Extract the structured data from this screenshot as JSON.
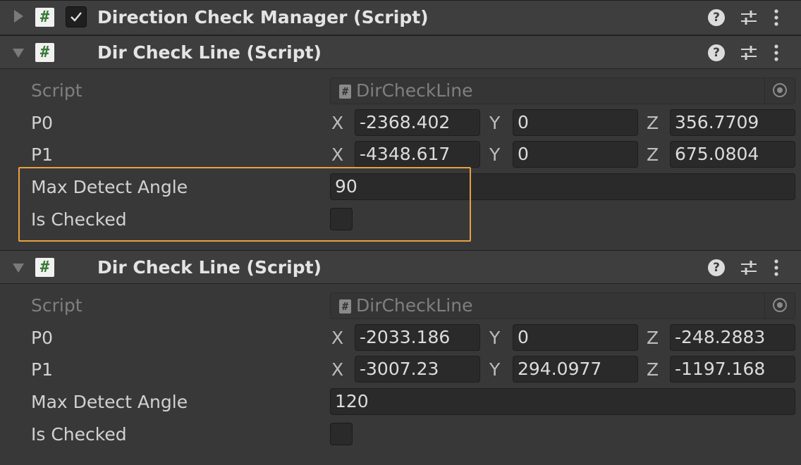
{
  "components": [
    {
      "title": "Direction Check Manager (Script)",
      "collapsed": true,
      "enabled": true
    },
    {
      "title": "Dir Check Line (Script)",
      "script_label": "Script",
      "script_value": "DirCheckLine",
      "p0_label": "P0",
      "p0": {
        "x": "-2368.402",
        "y": "0",
        "z": "356.7709"
      },
      "p1_label": "P1",
      "p1": {
        "x": "-4348.617",
        "y": "0",
        "z": "675.0804"
      },
      "max_angle_label": "Max Detect Angle",
      "max_angle": "90",
      "is_checked_label": "Is Checked",
      "is_checked": false
    },
    {
      "title": "Dir Check Line (Script)",
      "script_label": "Script",
      "script_value": "DirCheckLine",
      "p0_label": "P0",
      "p0": {
        "x": "-2033.186",
        "y": "0",
        "z": "-248.2883"
      },
      "p1_label": "P1",
      "p1": {
        "x": "-3007.23",
        "y": "294.0977",
        "z": "-1197.168"
      },
      "max_angle_label": "Max Detect Angle",
      "max_angle": "120",
      "is_checked_label": "Is Checked",
      "is_checked": false
    }
  ],
  "axes": {
    "x": "X",
    "y": "Y",
    "z": "Z"
  },
  "icons": {
    "script": "script-file-icon",
    "help": "help-icon",
    "presets": "presets-icon",
    "menu": "kebab-menu-icon",
    "picker": "object-picker-icon"
  },
  "glyphs": {
    "script": "#",
    "help": "?"
  },
  "colors": {
    "highlight": "#e8a140",
    "background": "#383838"
  }
}
